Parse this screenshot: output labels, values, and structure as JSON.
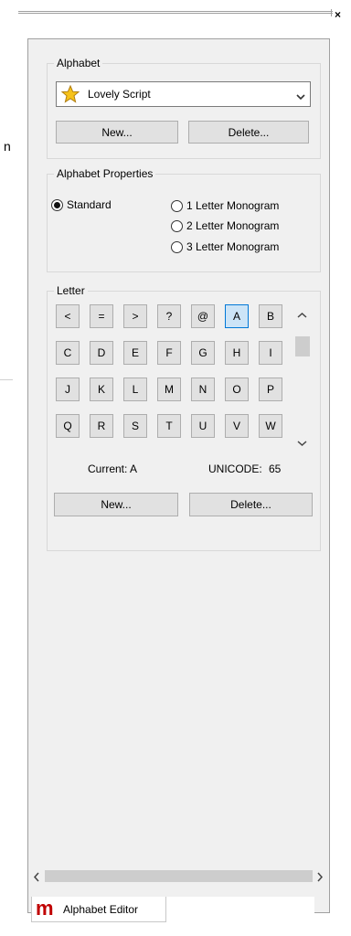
{
  "window": {
    "close_glyph": "×"
  },
  "background": {
    "edge_glyph": "n"
  },
  "alphabet": {
    "title": "Alphabet",
    "selected": "Lovely Script",
    "icon": "star-icon",
    "new_label": "New...",
    "delete_label": "Delete..."
  },
  "properties": {
    "title": "Alphabet Properties",
    "options": [
      "Standard",
      "1 Letter Monogram",
      "2 Letter Monogram",
      "3 Letter Monogram"
    ],
    "selected": "Standard"
  },
  "letter": {
    "title": "Letter",
    "keys": [
      [
        "<",
        "=",
        ">",
        "?",
        "@",
        "A",
        "B"
      ],
      [
        "C",
        "D",
        "E",
        "F",
        "G",
        "H",
        "I"
      ],
      [
        "J",
        "K",
        "L",
        "M",
        "N",
        "O",
        "P"
      ],
      [
        "Q",
        "R",
        "S",
        "T",
        "U",
        "V",
        "W"
      ]
    ],
    "selected_key": "A",
    "current_label": "Current: A",
    "unicode_label": "UNICODE:",
    "unicode_value": "65",
    "new_label": "New...",
    "delete_label": "Delete..."
  },
  "tab": {
    "label": "Alphabet Editor",
    "icon": "m-logo-icon",
    "icon_text": "m",
    "icon_color": "#c00000"
  },
  "colors": {
    "selected_key_bg": "#cce4f7",
    "selected_key_border": "#0078d7"
  }
}
